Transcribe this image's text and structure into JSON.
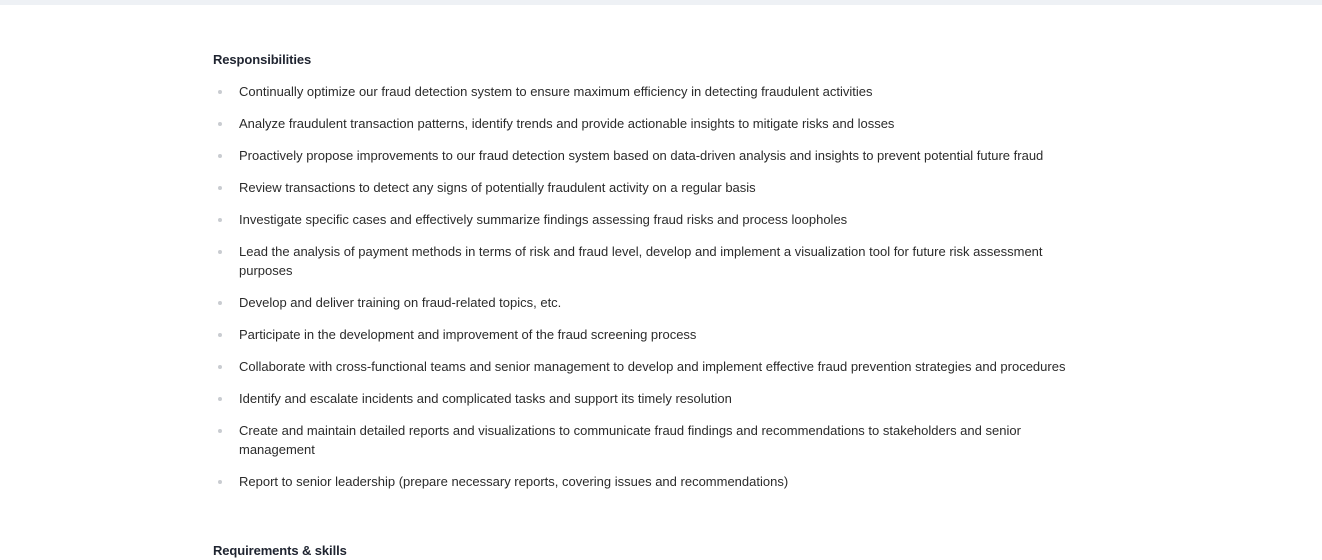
{
  "responsibilities": {
    "title": "Responsibilities",
    "items": [
      "Continually optimize our fraud detection system to ensure maximum efficiency in detecting fraudulent activities",
      "Analyze fraudulent transaction patterns, identify trends and provide actionable insights to mitigate risks and losses",
      "Proactively propose improvements to our fraud detection system based on data-driven analysis and insights to prevent potential future fraud",
      "Review transactions to detect any signs of potentially fraudulent activity on a regular basis",
      "Investigate specific cases and effectively summarize findings assessing fraud risks and process loopholes",
      "Lead the analysis of payment methods in terms of risk and fraud level, develop and implement a visualization tool for future risk assessment purposes",
      "Develop and deliver training on fraud-related topics, etc.",
      "Participate in the development and improvement of the fraud screening process",
      "Collaborate with cross-functional teams and senior management to develop and implement effective fraud prevention strategies and procedures",
      "Identify and escalate incidents and complicated tasks and support its timely resolution",
      "Create and maintain detailed reports and visualizations to communicate fraud findings and recommendations to stakeholders and senior management",
      "Report to senior leadership (prepare necessary reports, covering issues and recommendations)"
    ]
  },
  "requirements": {
    "title": "Requirements & skills"
  }
}
